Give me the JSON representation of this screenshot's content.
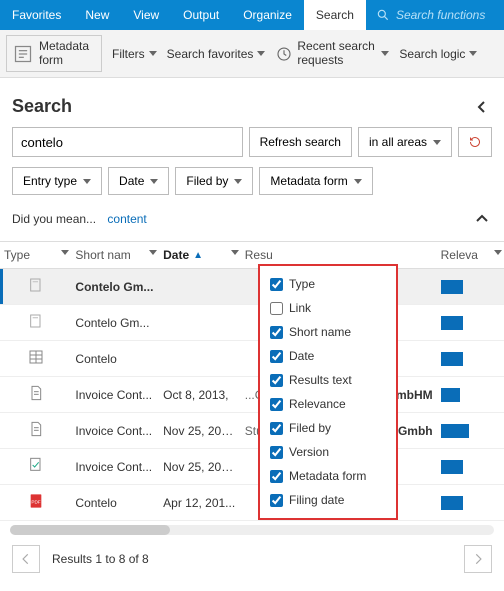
{
  "menubar": {
    "items": [
      "Favorites",
      "New",
      "View",
      "Output",
      "Organize",
      "Search"
    ],
    "active_index": 5,
    "search_placeholder": "Search functions"
  },
  "toolbar": {
    "metadata_form": "Metadata form",
    "filters": "Filters",
    "search_favorites": "Search favorites",
    "recent": "Recent search requests",
    "logic": "Search logic"
  },
  "section_title": "Search",
  "search": {
    "value": "contelo",
    "refresh": "Refresh search",
    "scope": "in all areas"
  },
  "filters": {
    "entry_type": "Entry type",
    "date": "Date",
    "filed_by": "Filed by",
    "metadata_form": "Metadata form"
  },
  "didyoumean": {
    "prompt": "Did you mean...",
    "suggestion": "content"
  },
  "columns": {
    "type": "Type",
    "short_name": "Short nam",
    "date": "Date",
    "results": "Resu",
    "relevance": "Releva"
  },
  "rows": [
    {
      "icon": "doc-gray",
      "short": "Contelo Gm...",
      "date": "",
      "results": "",
      "rel": 22,
      "selected": true
    },
    {
      "icon": "doc-gray",
      "short": "Contelo Gm...",
      "date": "",
      "results": "",
      "rel": 22
    },
    {
      "icon": "doc-table",
      "short": "Contelo",
      "date": "",
      "results": "",
      "rel": 22
    },
    {
      "icon": "doc-page",
      "short": "Invoice Cont...",
      "date": "Oct 8, 2013,",
      "results": "...GmbH",
      "rel": 19,
      "tail": "o GmbHM"
    },
    {
      "icon": "doc-page",
      "short": "Invoice Cont...",
      "date": "Nov 25, 201...",
      "results": "Stuttga",
      "rel": 28,
      "tail": "lo Gmbh"
    },
    {
      "icon": "doc-check",
      "short": "Invoice Cont...",
      "date": "Nov 25, 201...",
      "results": "",
      "rel": 22
    },
    {
      "icon": "doc-pdf",
      "short": "Contelo",
      "date": "Apr 12, 201...",
      "results": "",
      "rel": 22
    }
  ],
  "column_picker": [
    {
      "label": "Type",
      "checked": true
    },
    {
      "label": "Link",
      "checked": false
    },
    {
      "label": "Short name",
      "checked": true
    },
    {
      "label": "Date",
      "checked": true
    },
    {
      "label": "Results text",
      "checked": true
    },
    {
      "label": "Relevance",
      "checked": true
    },
    {
      "label": "Filed by",
      "checked": true
    },
    {
      "label": "Version",
      "checked": true
    },
    {
      "label": "Metadata form",
      "checked": true
    },
    {
      "label": "Filing date",
      "checked": true
    }
  ],
  "pager": {
    "text": "Results 1 to 8 of 8"
  }
}
